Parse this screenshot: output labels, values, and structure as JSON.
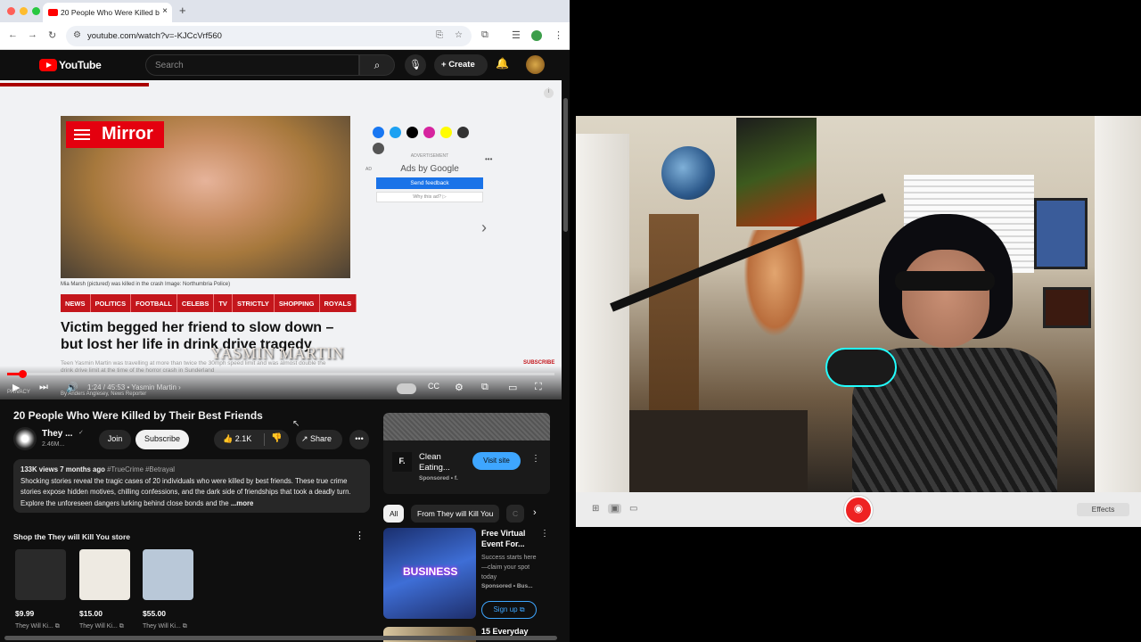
{
  "browser": {
    "tab_title": "20 People Who Were Killed b",
    "tab_close": "×",
    "new_tab": "+",
    "url": "youtube.com/watch?v=-KJCcVrf560"
  },
  "youtube": {
    "logo_text": "YouTube",
    "search_placeholder": "Search",
    "create_label": "Create"
  },
  "video_frame": {
    "mirror_logo": "Mirror",
    "photo_caption": "Mia Marsh (pictured) was killed in the crash  Image: Northumbria Police)",
    "ad_label": "ADVERTISEMENT",
    "ad_badge": "AD",
    "ads_by": "Ads by Google",
    "send_feedback": "Send feedback",
    "why_ad": "Why this ad? ▷",
    "categories": [
      "NEWS",
      "POLITICS",
      "FOOTBALL",
      "CELEBS",
      "TV",
      "STRICTLY",
      "SHOPPING",
      "ROYALS"
    ],
    "headline": "Victim begged her friend to slow down – but lost her life in drink drive tragedy",
    "overlay_name": "YASMIN MARTIN",
    "subtext": "Teen Yasmin Martin was travelling at more than twice the 30mph speed limit and was almost double the drink drive limit at the time of the horror crash in Sunderland",
    "byline": "By Anders Anglesey, News Reporter",
    "subscribe_tag": "SUBSCRIBE",
    "privacy": "PRIVACY"
  },
  "player": {
    "progress_fraction": 0.028,
    "time": "1:24 / 45:53",
    "chapter": "• Yasmin Martin  ›"
  },
  "video_info": {
    "title": "20 People Who Were Killed by Their Best Friends",
    "channel_short": "They ...",
    "subscribers": "2.46M...",
    "join": "Join",
    "subscribe": "Subscribe",
    "likes": "2.1K",
    "share": "Share",
    "more": "•••",
    "views_date": "133K views  7 months ago ",
    "hashtags": "#TrueCrime #Betrayal",
    "description": "Shocking stories reveal the tragic cases of 20 individuals who were killed by best friends. These true crime stories expose hidden motives, chilling confessions, and the dark side of friendships that took a deadly turn. Explore the unforeseen dangers lurking behind close bonds and the ",
    "more_link": "...more"
  },
  "store": {
    "heading": "Shop the They will Kill You store",
    "products": [
      {
        "price": "$9.99",
        "store": "They Will Ki...",
        "color": "#2a2a2a"
      },
      {
        "price": "$15.00",
        "store": "They Will Ki...",
        "color": "#eeeae2"
      },
      {
        "price": "$55.00",
        "store": "They Will Ki...",
        "color": "#b9c8d8"
      }
    ]
  },
  "sidebar": {
    "ad": {
      "logo": "F.",
      "name": "Clean Eating...",
      "sponsor": "Sponsored • f.",
      "visit": "Visit site"
    },
    "chips": [
      "All",
      "From They will Kill You",
      "C"
    ],
    "rec": {
      "title": "Free Virtual Event For...",
      "desc": "Success starts here—claim your spot today",
      "sponsor": "Sponsored • Bus...",
      "signup": "Sign up",
      "thumb_text": "BUSINESS"
    },
    "rec2_title": "15 Everyday"
  },
  "camera_app": {
    "effects": "Effects"
  }
}
